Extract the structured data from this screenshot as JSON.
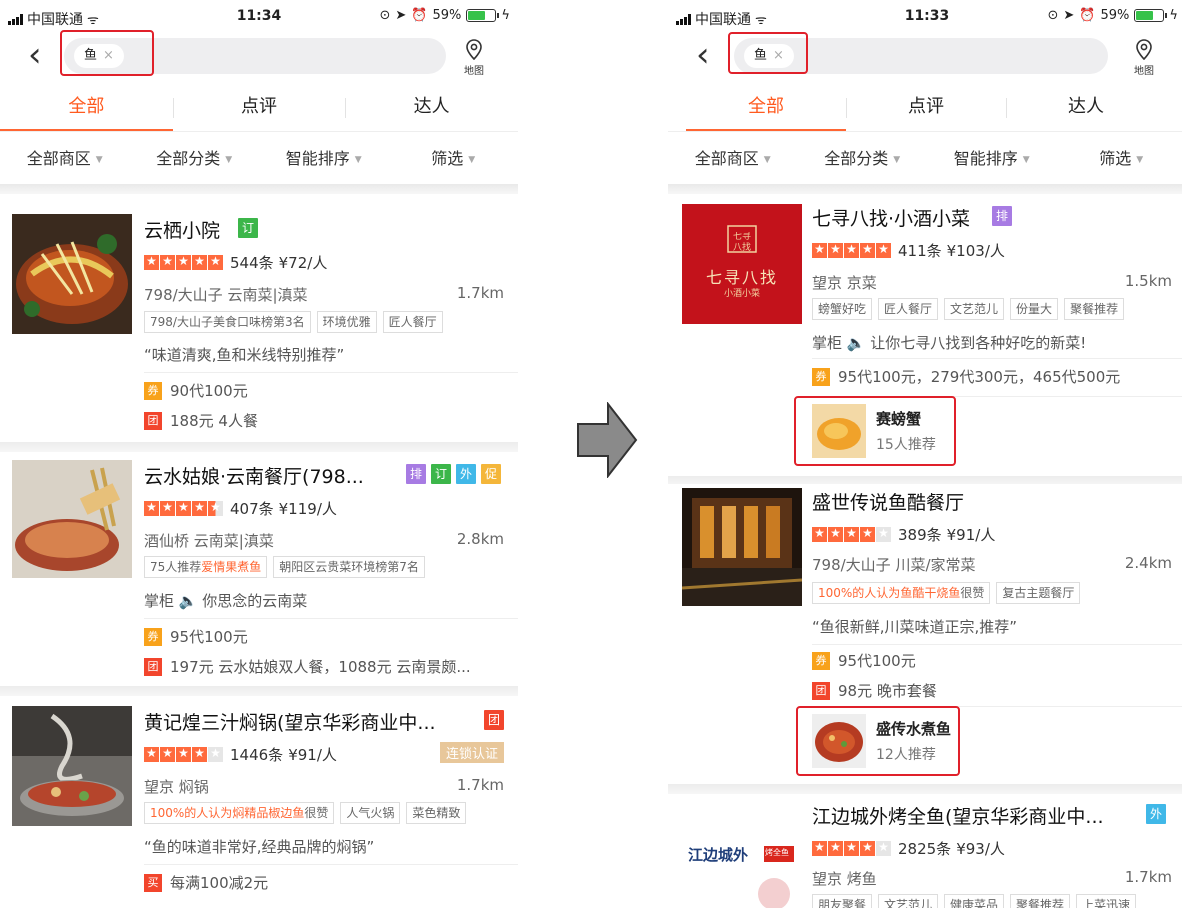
{
  "left": {
    "status": {
      "carrier": "中国联通",
      "time": "11:34",
      "battery": "59%"
    },
    "search": {
      "chip": "鱼",
      "clear": "×",
      "map_label": "地图"
    },
    "tabs": [
      "全部",
      "点评",
      "达人"
    ],
    "filters": [
      "全部商区",
      "全部分类",
      "智能排序",
      "筛选"
    ],
    "restaurants": [
      {
        "name": "云栖小院",
        "badges": [
          {
            "text": "订",
            "color": "#3cb64a"
          }
        ],
        "rating": 5,
        "reviews": "544条",
        "price": "¥72/人",
        "area": "798/大山子 云南菜|滇菜",
        "distance": "1.7km",
        "tags": [
          {
            "text": "798/大山子美食口味榜第3名"
          },
          {
            "text": "环境优雅"
          },
          {
            "text": "匠人餐厅"
          }
        ],
        "quote": "“味道清爽,鱼和米线特别推荐”",
        "deals": [
          {
            "icon": "券",
            "color": "yellow",
            "text": "90代100元"
          },
          {
            "icon": "团",
            "color": "red",
            "text": "188元 4人餐"
          }
        ]
      },
      {
        "name": "云水姑娘·云南餐厅(798...",
        "badges": [
          {
            "text": "排",
            "color": "#a77be3"
          },
          {
            "text": "订",
            "color": "#3cb64a"
          },
          {
            "text": "外",
            "color": "#40b8e8"
          },
          {
            "text": "促",
            "color": "#f4b63a"
          }
        ],
        "rating": 4.5,
        "reviews": "407条",
        "price": "¥119/人",
        "area": "酒仙桥 云南菜|滇菜",
        "distance": "2.8km",
        "tags": [
          {
            "pre": "75人推荐",
            "hl": "爱情果煮鱼",
            "post": ""
          },
          {
            "text": "朝阳区云贵菜环境榜第7名"
          }
        ],
        "quote": "掌柜 🔈 你思念的云南菜",
        "deals": [
          {
            "icon": "券",
            "color": "yellow",
            "text": "95代100元"
          },
          {
            "icon": "团",
            "color": "red",
            "text": "197元 云水姑娘双人餐，1088元 云南景颇..."
          }
        ]
      },
      {
        "name": "黄记煌三汁焖锅(望京华彩商业中...",
        "badges": [
          {
            "text": "团",
            "color": "#f2452c"
          }
        ],
        "rating": 4,
        "reviews": "1446条",
        "price": "¥91/人",
        "chain": "连锁认证",
        "area": "望京 焖锅",
        "distance": "1.7km",
        "tags": [
          {
            "pre": "100%的人认为",
            "hl": "焖精品椒边鱼",
            "post": "很赞"
          },
          {
            "text": "人气火锅"
          },
          {
            "text": "菜色精致"
          }
        ],
        "quote": "“鱼的味道非常好,经典品牌的焖锅”",
        "deals": [
          {
            "icon": "买",
            "color": "red",
            "text": "每满100减2元"
          }
        ]
      }
    ]
  },
  "right": {
    "status": {
      "carrier": "中国联通",
      "time": "11:33",
      "battery": "59%"
    },
    "search": {
      "chip": "鱼",
      "clear": "×",
      "map_label": "地图"
    },
    "tabs": [
      "全部",
      "点评",
      "达人"
    ],
    "filters": [
      "全部商区",
      "全部分类",
      "智能排序",
      "筛选"
    ],
    "restaurants": [
      {
        "name": "七寻八找·小酒小菜",
        "badges": [
          {
            "text": "排",
            "color": "#a77be3"
          }
        ],
        "rating": 5,
        "reviews": "411条",
        "price": "¥103/人",
        "area": "望京 京菜",
        "distance": "1.5km",
        "tags": [
          {
            "text": "螃蟹好吃"
          },
          {
            "text": "匠人餐厅"
          },
          {
            "text": "文艺范儿"
          },
          {
            "text": "份量大"
          },
          {
            "text": "聚餐推荐"
          }
        ],
        "quote": "掌柜 🔈 让你七寻八找到各种好吃的新菜!",
        "deals": [
          {
            "icon": "券",
            "color": "yellow",
            "text": "95代100元，279代300元，465代500元"
          }
        ],
        "rec": {
          "name": "赛螃蟹",
          "count": "15人推荐"
        },
        "logo": {
          "main": "七寻八找",
          "sub": "小酒小菜",
          "seal": "七寻八找"
        }
      },
      {
        "name": "盛世传说鱼酷餐厅",
        "badges": [],
        "rating": 4,
        "reviews": "389条",
        "price": "¥91/人",
        "area": "798/大山子 川菜/家常菜",
        "distance": "2.4km",
        "tags": [
          {
            "pre": "100%的人认为",
            "hl": "鱼酷干烧鱼",
            "post": "很赞"
          },
          {
            "text": "复古主题餐厅"
          }
        ],
        "quote": "“鱼很新鲜,川菜味道正宗,推荐”",
        "deals": [
          {
            "icon": "券",
            "color": "yellow",
            "text": "95代100元"
          },
          {
            "icon": "团",
            "color": "red",
            "text": "98元 晚市套餐"
          }
        ],
        "rec": {
          "name": "盛传水煮鱼",
          "count": "12人推荐"
        }
      },
      {
        "name": "江边城外烤全鱼(望京华彩商业中...",
        "badges": [
          {
            "text": "外",
            "color": "#40b8e8"
          }
        ],
        "rating": 4,
        "reviews": "2825条",
        "price": "¥93/人",
        "area": "望京 烤鱼",
        "distance": "1.7km",
        "tags": [
          {
            "text": "朋友聚餐"
          },
          {
            "text": "文艺范儿"
          },
          {
            "text": "健康菜品"
          },
          {
            "text": "聚餐推荐"
          },
          {
            "text": "上菜迅速"
          }
        ],
        "logo": {
          "main": "江边城外",
          "tag": "烤全鱼"
        }
      }
    ]
  }
}
